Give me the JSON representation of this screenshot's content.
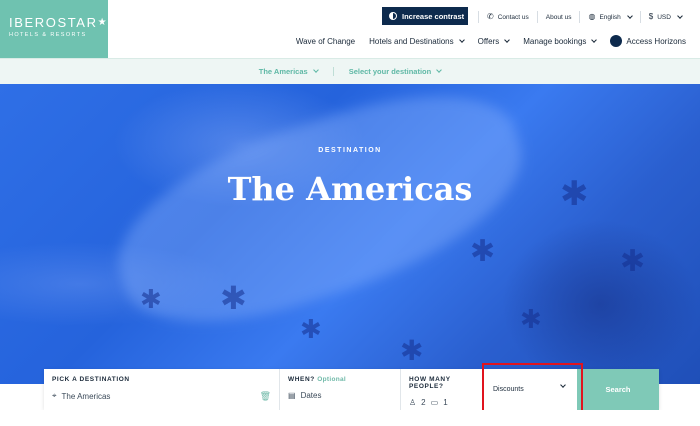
{
  "brand": {
    "name": "IBEROSTAR",
    "star": "★",
    "tagline": "HOTELS & RESORTS"
  },
  "header": {
    "contrast_label": "Increase contrast",
    "utility": [
      {
        "label": "Contact us",
        "icon": "phone-icon"
      },
      {
        "label": "About us"
      },
      {
        "label": "English",
        "icon": "globe-icon"
      },
      {
        "label": "USD",
        "icon": "currency-icon"
      }
    ],
    "nav": [
      {
        "label": "Wave of Change"
      },
      {
        "label": "Hotels and Destinations"
      },
      {
        "label": "Offers"
      },
      {
        "label": "Manage bookings"
      },
      {
        "label": "Access Horizons"
      }
    ]
  },
  "subnav": {
    "region": "The Americas",
    "destination": "Select your destination"
  },
  "hero": {
    "eyebrow": "DESTINATION",
    "title": "The Americas"
  },
  "search": {
    "destination_label": "PICK A DESTINATION",
    "destination_value": "The Americas",
    "when_label": "WHEN?",
    "when_optional": "Optional",
    "when_value": "Dates",
    "people_label": "HOW MANY PEOPLE?",
    "adults": "2",
    "rooms": "1",
    "discounts_label": "Discounts",
    "search_label": "Search"
  },
  "colors": {
    "brand_teal": "#6fc2b0",
    "navy": "#0d2a4d",
    "hero_blue": "#2563dc",
    "highlight_red": "#e0141e"
  }
}
